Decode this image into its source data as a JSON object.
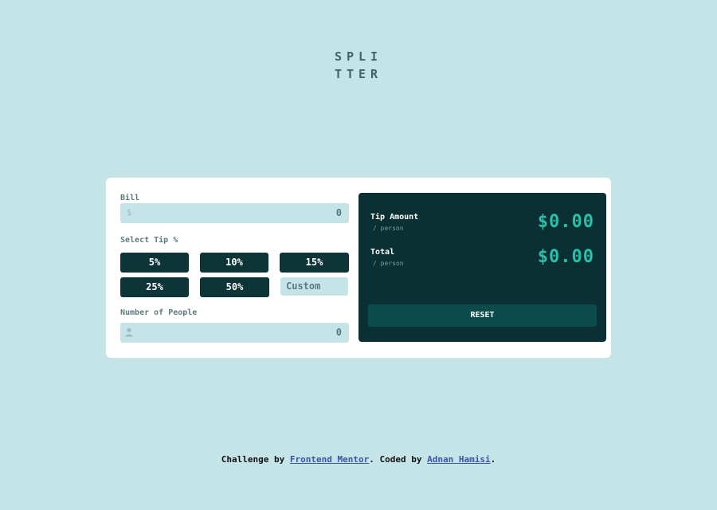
{
  "logo": {
    "line1": "SPLI",
    "line2": "TTER"
  },
  "bill": {
    "label": "Bill",
    "icon": "dollar-icon",
    "value": "0"
  },
  "tip": {
    "label": "Select Tip %",
    "options": [
      "5%",
      "10%",
      "15%",
      "25%",
      "50%"
    ],
    "custom_placeholder": "Custom"
  },
  "people": {
    "label": "Number of People",
    "icon": "person-icon",
    "value": "0"
  },
  "results": {
    "tip_label": "Tip Amount",
    "tip_sub": "/ person",
    "tip_value": "$0.00",
    "total_label": "Total",
    "total_sub": "/ person",
    "total_value": "$0.00",
    "reset_label": "RESET"
  },
  "footer": {
    "prefix": "Challenge by ",
    "link1": "Frontend Mentor",
    "middle": ". Coded by ",
    "link2": "Adnan Hamisi",
    "suffix": "."
  },
  "colors": {
    "background": "#c5e4e7",
    "dark": "#0d3436",
    "accent": "#26c0ab"
  }
}
